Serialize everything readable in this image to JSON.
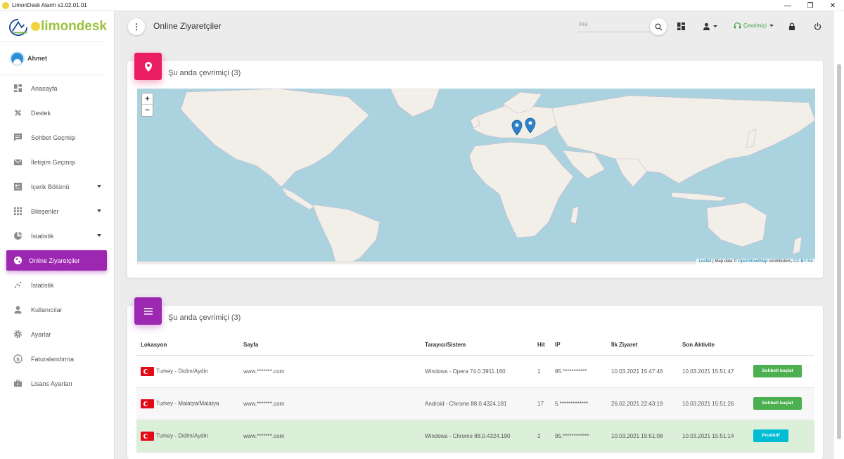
{
  "window": {
    "title": "LimonDesk Alarm s1.02.01.01",
    "controls": [
      "—",
      "❐",
      "✕"
    ]
  },
  "brand": {
    "name": "limondesk"
  },
  "user": {
    "name": "Ahmet"
  },
  "sidebar": {
    "items": [
      {
        "label": "Anasayfa",
        "icon": "dashboard-icon"
      },
      {
        "label": "Destek",
        "icon": "support-icon"
      },
      {
        "label": "Sohbet Geçmişi",
        "icon": "chat-icon"
      },
      {
        "label": "İletişim Geçmişi",
        "icon": "mail-icon"
      },
      {
        "label": "İçerik Bölümü",
        "icon": "content-icon"
      },
      {
        "label": "Bileşenler",
        "icon": "apps-icon"
      },
      {
        "label": "İstatistik",
        "icon": "pie-chart-icon"
      },
      {
        "label": "Online Ziyaretçiler",
        "icon": "globe-icon"
      },
      {
        "label": "İstatistik",
        "icon": "scatter-icon"
      },
      {
        "label": "Kullanıcılar",
        "icon": "person-icon"
      },
      {
        "label": "Ayarlar",
        "icon": "gear-icon"
      },
      {
        "label": "Faturalandırma",
        "icon": "dollar-icon"
      },
      {
        "label": "Lisans Ayarları",
        "icon": "briefcase-icon"
      }
    ]
  },
  "header": {
    "title": "Online Ziyaretçiler",
    "search_placeholder": "Ara",
    "status_label": "Çevrimiçi"
  },
  "map_card": {
    "title": "Şu anda çevrimiçi (3)",
    "zoom_in": "+",
    "zoom_out": "−",
    "attribution_leaflet": "Leaflet",
    "attribution_text": " | Map data © ",
    "attribution_osm": "OpenStreetMap",
    "attribution_contrib": " contributors, ",
    "attribution_license": "CC-BY-SA"
  },
  "table_card": {
    "title": "Şu anda çevrimiçi (3)",
    "columns": [
      "Lokasyon",
      "Sayfa",
      "Tarayıcı/Sistem",
      "Hit",
      "IP",
      "İlk Ziyaret",
      "Son Aktivite",
      ""
    ],
    "rows": [
      {
        "location": "Turkey - Didim/Aydin",
        "page": "www.*******.com",
        "browser": "Windows - Opera 74.0.3911.160",
        "hit": "1",
        "ip": "95.***********",
        "first": "10.03.2021 15:47:46",
        "last": "10.03.2021 15:51:47",
        "action": "Sohbeti başlat"
      },
      {
        "location": "Turkey - Malatya/Malatya",
        "page": "www.*******.com",
        "browser": "Android - Chrome 88.0.4324.181",
        "hit": "17",
        "ip": "5.*************",
        "first": "26.02.2021 22:43:19",
        "last": "10.03.2021 15:51:26",
        "action": "Sohbeti başlat"
      },
      {
        "location": "Turkey - Didim/Aydin",
        "page": "www.*******.com",
        "browser": "Windows - Chrome 88.0.4324.190",
        "hit": "2",
        "ip": "95.************",
        "first": "10.03.2021 15:51:08",
        "last": "10.03.2021 15:51:14",
        "action": "ProAktif"
      }
    ]
  }
}
